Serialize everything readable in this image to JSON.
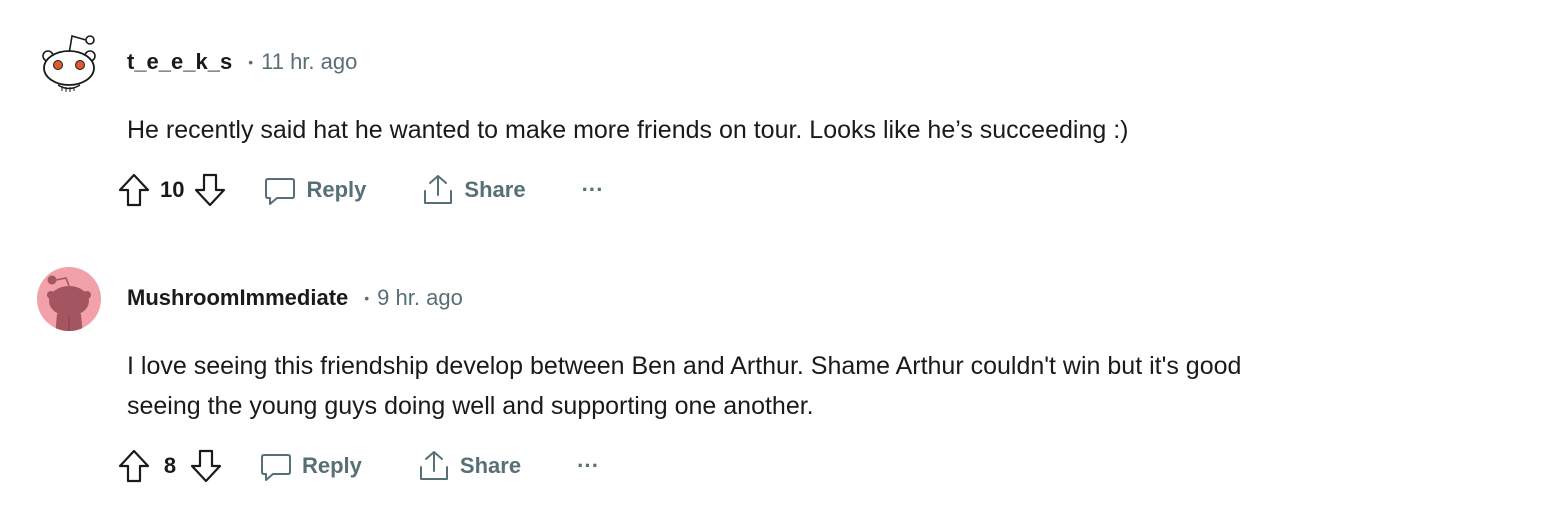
{
  "comments": [
    {
      "username": "t_e_e_k_s",
      "separator": "•",
      "time": "11 hr. ago",
      "body": [
        "He recently said hat he wanted to make more friends on tour. Looks like he’s succeeding :)"
      ],
      "score": "10",
      "avatar_icon": "snoo-avatar-icon",
      "reply_label": "Reply",
      "share_label": "Share",
      "more_label": "···"
    },
    {
      "username": "MushroomImmediate",
      "separator": "•",
      "time": "9 hr. ago",
      "body": [
        "I love seeing this friendship develop between Ben and Arthur. Shame Arthur couldn't win but it's good",
        "seeing the young guys doing well and supporting one another."
      ],
      "score": "8",
      "avatar_icon": "snoo-avatar-icon",
      "reply_label": "Reply",
      "share_label": "Share",
      "more_label": "···"
    }
  ],
  "colors": {
    "text": "#1a1a1b",
    "meta": "#576f76",
    "avatar_pink_bg": "#f2a0aa",
    "avatar_dark": "#a35560",
    "snoo_eye": "#e05a2b"
  },
  "icons": {
    "upvote": "upvote-arrow-icon",
    "downvote": "downvote-arrow-icon",
    "reply": "speech-bubble-icon",
    "share": "share-upload-icon",
    "more": "ellipsis-icon"
  }
}
